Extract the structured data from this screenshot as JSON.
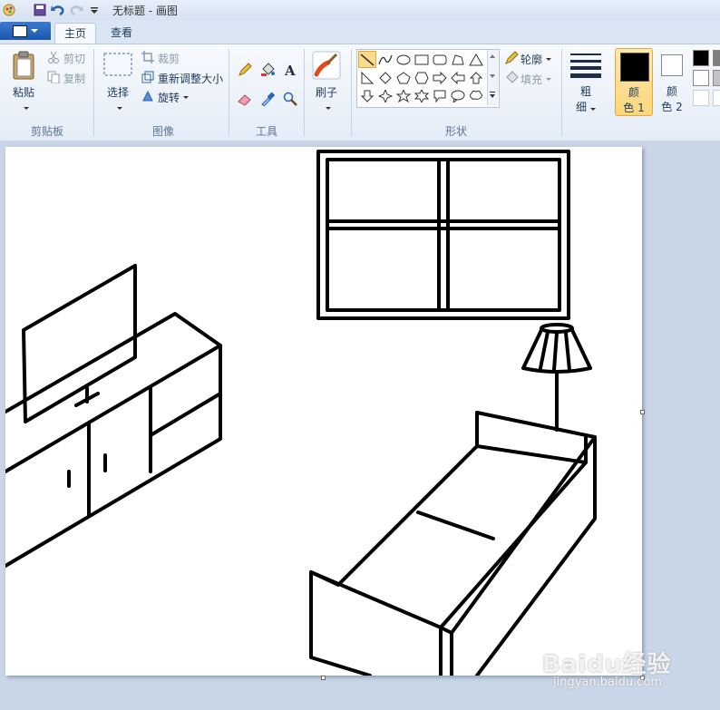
{
  "window": {
    "title": "无标题 - 画图"
  },
  "tabs": [
    {
      "label": "主页"
    },
    {
      "label": "查看"
    }
  ],
  "clipboard": {
    "paste_label": "粘贴",
    "cut_label": "剪切",
    "copy_label": "复制",
    "group_label": "剪贴板"
  },
  "image": {
    "select_label": "选择",
    "crop_label": "裁剪",
    "resize_label": "重新调整大小",
    "rotate_label": "旋转",
    "group_label": "图像"
  },
  "tools": {
    "group_label": "工具"
  },
  "brushes": {
    "label": "刷子"
  },
  "shapes": {
    "outline_label": "轮廓",
    "fill_label": "填充",
    "group_label": "形状"
  },
  "size": {
    "label_line1": "粗",
    "label_line2": "细"
  },
  "colors": {
    "color1_line1": "颜",
    "color1_line2": "色 1",
    "color2_line1": "颜",
    "color2_line2": "色 2",
    "color1_value": "#000000",
    "color2_value": "#ffffff"
  },
  "watermark": {
    "brand": "Baidu经验",
    "url": "jingyan.baidu.com"
  }
}
